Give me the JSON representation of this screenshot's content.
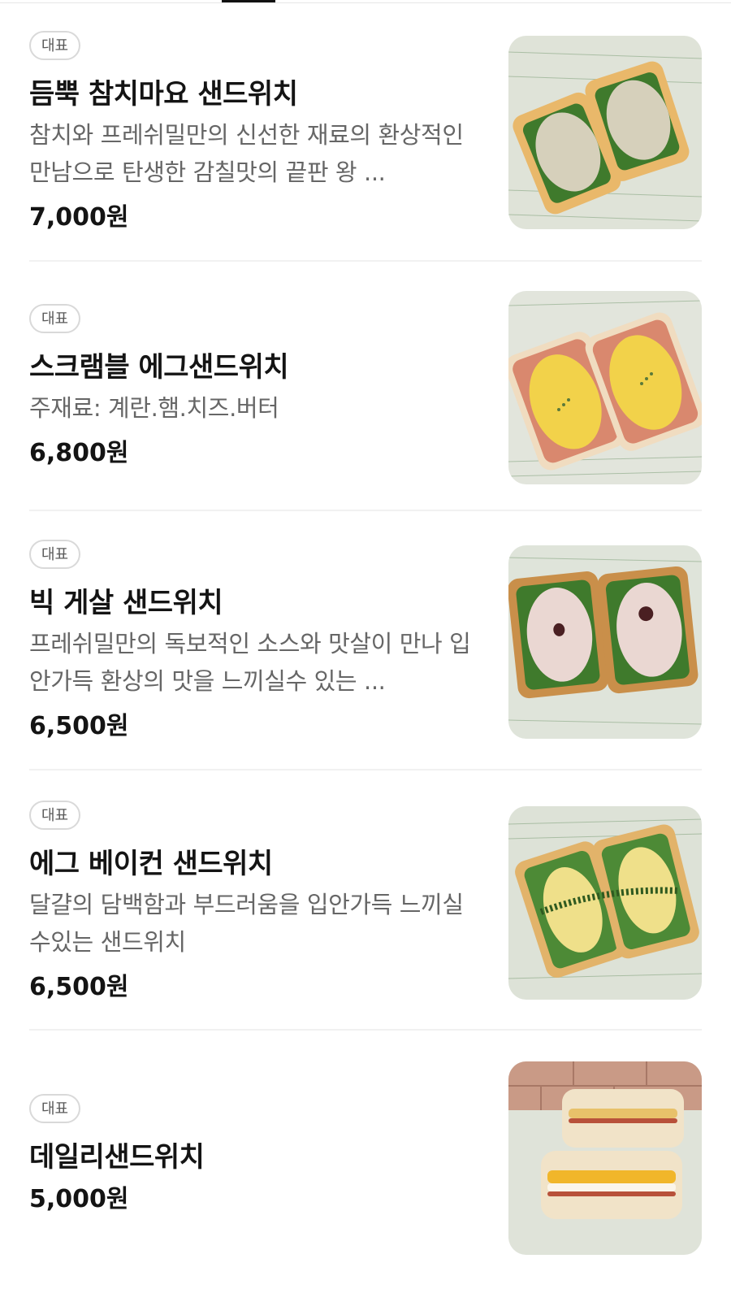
{
  "menu": {
    "items": [
      {
        "badge": "대표",
        "name": "듬뿍 참치마요 샌드위치",
        "description": "참치와 프레쉬밀만의 신선한 재료의 환상적인 만남으로 탄생한 감칠맛의 끝판 왕 ...",
        "price": "7,000원",
        "image_icon": "tuna-sandwich-photo"
      },
      {
        "badge": "대표",
        "name": "스크램블 에그샌드위치",
        "description": "주재료: 계란.햄.치즈.버터",
        "price": "6,800원",
        "image_icon": "scrambled-egg-sandwich-photo"
      },
      {
        "badge": "대표",
        "name": "빅 게살 샌드위치",
        "description": "프레쉬밀만의 독보적인 소스와 맛살이 만나 입안가득 환상의 맛을 느끼실수 있는 ...",
        "price": "6,500원",
        "image_icon": "crab-sandwich-photo"
      },
      {
        "badge": "대표",
        "name": "에그 베이컨 샌드위치",
        "description": "달걀의 담백함과 부드러움을 입안가득 느끼실수있는 샌드위치",
        "price": "6,500원",
        "image_icon": "egg-bacon-sandwich-photo"
      },
      {
        "badge": "대표",
        "name": "데일리샌드위치",
        "description": "",
        "price": "5,000원",
        "image_icon": "daily-sandwich-photo"
      }
    ]
  },
  "colors": {
    "badge_border": "#d9d9d9",
    "text_primary": "#141414",
    "text_secondary": "#666666",
    "divider": "#f1f1f1",
    "paper": "#dfe3d8",
    "bread": "#e9b86a",
    "filling_tuna": "#d6d0bb",
    "filling_egg": "#f2d24a",
    "filling_crab": "#ead7d2",
    "lettuce": "#3f7a2c"
  }
}
